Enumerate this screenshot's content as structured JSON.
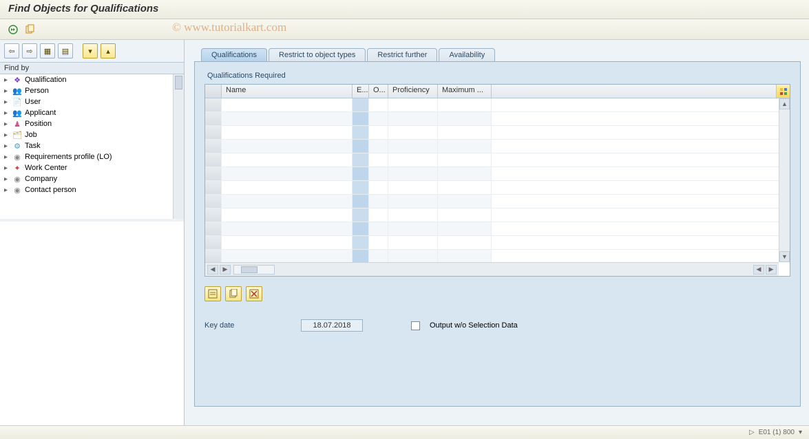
{
  "title": "Find Objects for Qualifications",
  "watermark": "© www.tutorialkart.com",
  "sidebar": {
    "findby_label": "Find by",
    "items": [
      {
        "label": "Qualification",
        "icon": "qual-icon",
        "color": "#7b3fc4",
        "glyph": "❖"
      },
      {
        "label": "Person",
        "icon": "person-icon",
        "color": "#e08030",
        "glyph": "👥"
      },
      {
        "label": "User",
        "icon": "user-icon",
        "color": "#e0b030",
        "glyph": "📄"
      },
      {
        "label": "Applicant",
        "icon": "applicant-icon",
        "color": "#e08030",
        "glyph": "👥"
      },
      {
        "label": "Position",
        "icon": "position-icon",
        "color": "#d05090",
        "glyph": "♟"
      },
      {
        "label": "Job",
        "icon": "job-icon",
        "color": "#d0a020",
        "glyph": "🗂"
      },
      {
        "label": "Task",
        "icon": "task-icon",
        "color": "#4aa0d8",
        "glyph": "⚙"
      },
      {
        "label": "Requirements profile (LO)",
        "icon": "req-icon",
        "color": "#888",
        "glyph": "◉"
      },
      {
        "label": "Work Center",
        "icon": "workcenter-icon",
        "color": "#d04040",
        "glyph": "✦"
      },
      {
        "label": "Company",
        "icon": "company-icon",
        "color": "#888",
        "glyph": "◉"
      },
      {
        "label": "Contact person",
        "icon": "contact-icon",
        "color": "#888",
        "glyph": "◉"
      }
    ]
  },
  "tabs": [
    {
      "label": "Qualifications",
      "active": true
    },
    {
      "label": "Restrict to object types",
      "active": false
    },
    {
      "label": "Restrict further",
      "active": false
    },
    {
      "label": "Availability",
      "active": false
    }
  ],
  "grid": {
    "title": "Qualifications Required",
    "columns": [
      "Name",
      "E...",
      "O...",
      "Proficiency",
      "Maximum ..."
    ],
    "row_count": 12
  },
  "form": {
    "key_date_label": "Key date",
    "key_date_value": "18.07.2018",
    "checkbox_label": "Output w/o Selection Data"
  },
  "status": "E01 (1) 800"
}
